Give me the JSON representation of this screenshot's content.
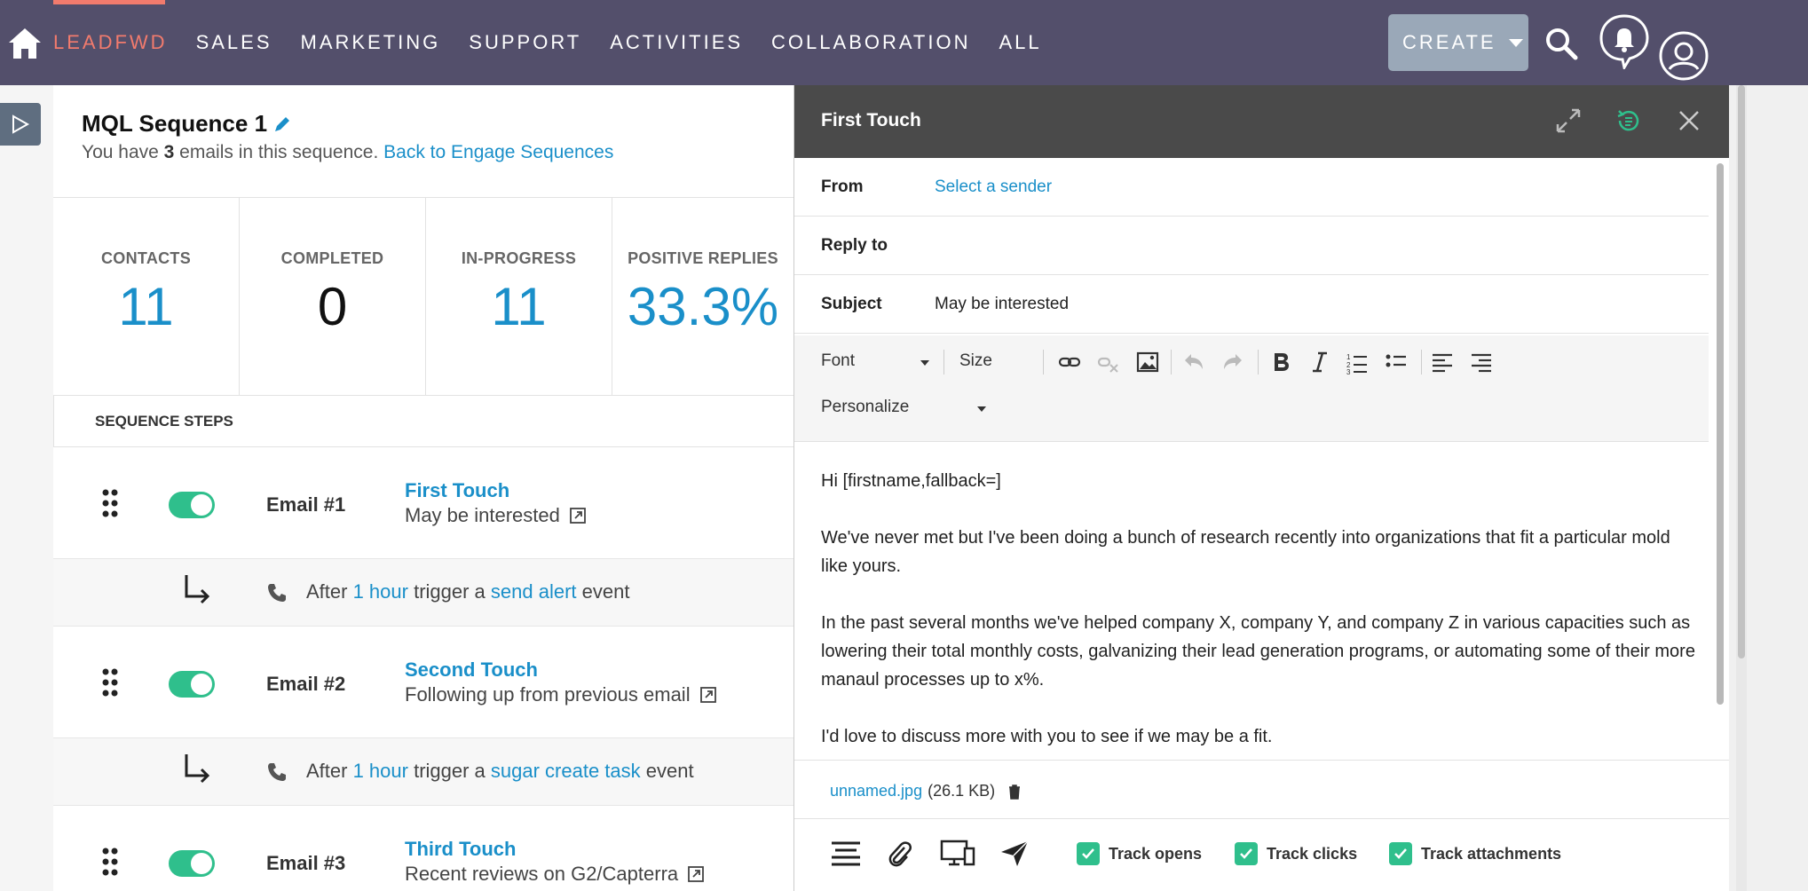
{
  "nav": {
    "items": [
      "LEADFWD",
      "SALES",
      "MARKETING",
      "SUPPORT",
      "ACTIVITIES",
      "COLLABORATION",
      "ALL"
    ],
    "active_index": 0,
    "create_label": "CREATE",
    "accent_color": "#f27b6d",
    "bg_color": "#534f6b"
  },
  "sequence": {
    "title": "MQL Sequence 1",
    "subtitle_prefix": "You have ",
    "email_count": "3",
    "subtitle_suffix": " emails in this sequence.",
    "back_link": "Back to Engage Sequences"
  },
  "stats": [
    {
      "label": "CONTACTS",
      "value": "11"
    },
    {
      "label": "COMPLETED",
      "value": "0"
    },
    {
      "label": "IN-PROGRESS",
      "value": "11"
    },
    {
      "label": "POSITIVE REPLIES",
      "value": "33.3%"
    }
  ],
  "steps_header": "SEQUENCE STEPS",
  "steps": [
    {
      "num": "Email #1",
      "name": "First Touch",
      "subject": "May be interested"
    },
    {
      "num": "Email #2",
      "name": "Second Touch",
      "subject": "Following up from previous email"
    },
    {
      "num": "Email #3",
      "name": "Third Touch",
      "subject": "Recent reviews on G2/Capterra"
    }
  ],
  "triggers": [
    {
      "after": "After ",
      "delay": "1 hour",
      "mid": " trigger a ",
      "event": "send alert",
      "end": " event"
    },
    {
      "after": "After ",
      "delay": "1 hour",
      "mid": " trigger a ",
      "event": "sugar create task",
      "end": " event"
    }
  ],
  "editor": {
    "title": "First Touch",
    "from_label": "From",
    "from_value": "Select a sender",
    "reply_label": "Reply to",
    "reply_value": "",
    "subject_label": "Subject",
    "subject_value": "May be interested",
    "font_label": "Font",
    "size_label": "Size",
    "personalize_label": "Personalize",
    "body": [
      "Hi [firstname,fallback=]",
      "We've never met but I've been doing a bunch of research recently into organizations that fit a particular mold like yours.",
      "In the past several months we've helped company X, company Y, and company Z in various capacities such as lowering their total monthly costs, galvanizing their lead generation programs, or automating some of their more manaul processes up to x%.",
      "I'd love to discuss more with you to see if we may be a fit."
    ],
    "attachment_name": "unnamed.jpg",
    "attachment_size": "(26.1 KB)",
    "track_opens": "Track opens",
    "track_clicks": "Track clicks",
    "track_attachments": "Track attachments"
  }
}
